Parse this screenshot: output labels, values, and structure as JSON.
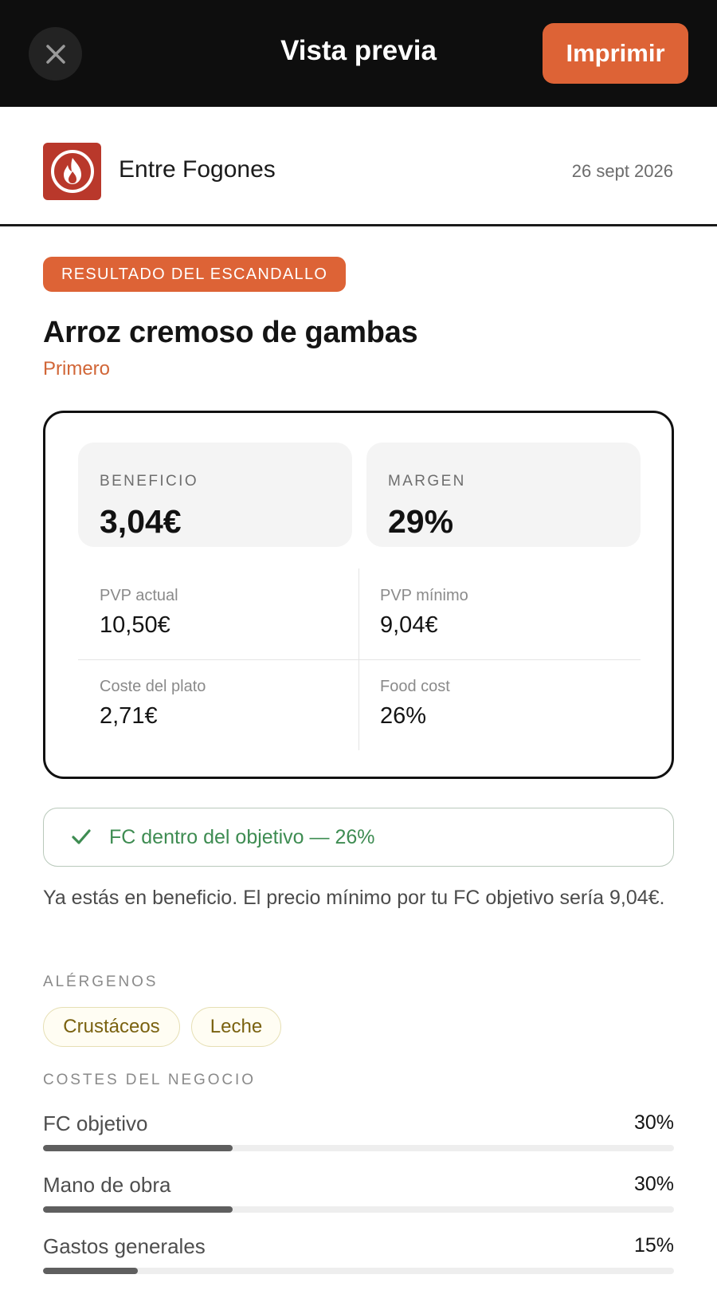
{
  "topbar": {
    "title": "Vista previa",
    "print_label": "Imprimir"
  },
  "header": {
    "brand": "Entre Fogones",
    "date": "26 sept 2026"
  },
  "badge": "RESULTADO DEL ESCANDALLO",
  "dish": {
    "name": "Arroz cremoso de gambas",
    "category": "Primero"
  },
  "kpis": {
    "profit_label": "BENEFICIO",
    "profit_value": "3,04€",
    "margin_label": "MARGEN",
    "margin_value": "29%"
  },
  "metrics": [
    {
      "label": "PVP actual",
      "value": "10,50€"
    },
    {
      "label": "PVP mínimo",
      "value": "9,04€"
    },
    {
      "label": "Coste del plato",
      "value": "2,71€"
    },
    {
      "label": "Food cost",
      "value": "26%"
    }
  ],
  "status": {
    "text": "FC dentro del objetivo — 26%",
    "color": "#3e8c52"
  },
  "note": "Ya estás en beneficio. El precio mínimo por tu FC objetivo sería 9,04€.",
  "allergens": {
    "label": "ALÉRGENOS",
    "items": [
      "Crustáceos",
      "Leche"
    ]
  },
  "costs": {
    "label": "COSTES DEL NEGOCIO",
    "items": [
      {
        "label": "FC objetivo",
        "value": "30%",
        "percent": 30
      },
      {
        "label": "Mano de obra",
        "value": "30%",
        "percent": 30
      },
      {
        "label": "Gastos generales",
        "value": "15%",
        "percent": 15
      }
    ]
  },
  "colors": {
    "accent": "#dd6336",
    "topbar": "#0e0e0e",
    "logo": "#b9382b",
    "success": "#3e8c52"
  },
  "icons": {
    "close": "close-icon",
    "logo": "flame-logo-icon",
    "status": "check-icon"
  }
}
